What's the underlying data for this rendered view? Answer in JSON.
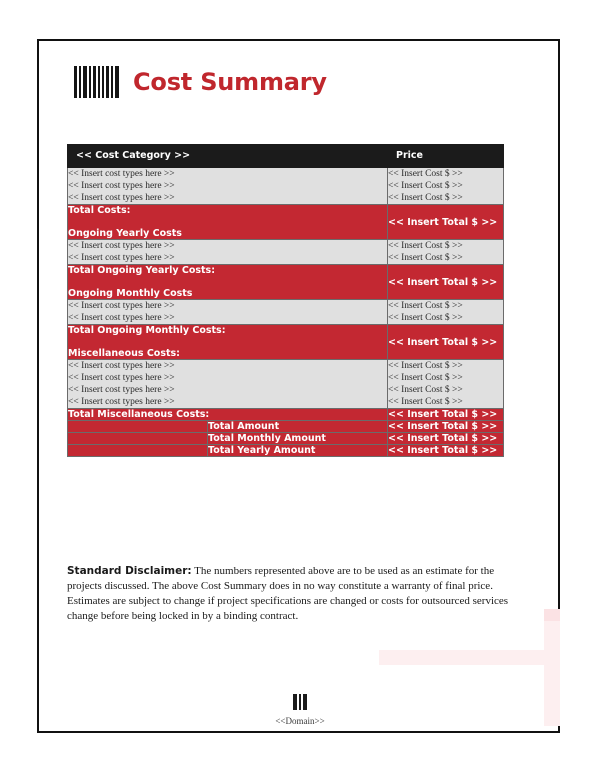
{
  "document": {
    "title": "Cost Summary",
    "logo_icon": "barcode-icon"
  },
  "table": {
    "headers": {
      "category": "<< Cost Category >>",
      "price": "Price"
    },
    "placeholders": {
      "cost_type": "<< Insert cost types here >>",
      "cost_price": "<< Insert Cost $ >>",
      "total_price": "<< Insert Total $ >>"
    },
    "sections": [
      {
        "rows": [
          {
            "label": "<< Insert cost types here >>",
            "price": "<< Insert Cost $ >>"
          },
          {
            "label": "<< Insert cost types here >>",
            "price": "<< Insert Cost $ >>"
          },
          {
            "label": "<< Insert cost types here >>",
            "price": "<< Insert Cost $ >>"
          }
        ],
        "total_label": "Total Costs:",
        "next_heading": "Ongoing Yearly Costs",
        "total_price": "<< Insert Total $ >>"
      },
      {
        "rows": [
          {
            "label": "<< Insert cost types here >>",
            "price": "<< Insert Cost $ >>"
          },
          {
            "label": "<< Insert cost types here >>",
            "price": "<< Insert Cost $ >>"
          }
        ],
        "total_label": "Total Ongoing Yearly Costs:",
        "next_heading": "Ongoing Monthly Costs",
        "total_price": "<< Insert Total $ >>"
      },
      {
        "rows": [
          {
            "label": "<< Insert cost types here >>",
            "price": "<< Insert Cost $ >>"
          },
          {
            "label": "<< Insert cost types here >>",
            "price": "<< Insert Cost $ >>"
          }
        ],
        "total_label": "Total Ongoing Monthly Costs:",
        "next_heading": "Miscellaneous Costs:",
        "total_price": "<< Insert Total $ >>"
      },
      {
        "rows": [
          {
            "label": "<< Insert cost types here >>",
            "price": "<< Insert Cost $ >>"
          },
          {
            "label": "<< Insert cost types here >>",
            "price": "<< Insert Cost $ >>"
          },
          {
            "label": "<< Insert cost types here >>",
            "price": "<< Insert Cost $ >>"
          },
          {
            "label": "<< Insert cost types here >>",
            "price": "<< Insert Cost $ >>"
          }
        ],
        "total_label": "Total Miscellaneous Costs:",
        "next_heading": "",
        "total_price": "<< Insert Total $ >>"
      }
    ],
    "grand_totals": [
      {
        "label": "Total Amount",
        "price": "<< Insert Total $ >>"
      },
      {
        "label": "Total Monthly Amount",
        "price": "<< Insert Total $ >>"
      },
      {
        "label": "Total Yearly Amount",
        "price": "<< Insert Total $ >>"
      }
    ]
  },
  "disclaimer": {
    "heading": "Standard Disclaimer:",
    "body": " The numbers represented above are to be used as an estimate for the projects discussed. The above Cost Summary does in no way constitute a warranty of final price.  Estimates are subject to change if project specifications are changed or costs for outsourced services change before being locked in by a binding contract."
  },
  "footer": {
    "label": "<<Domain>>",
    "logo_icon": "barcode-icon"
  },
  "colors": {
    "brand_red": "#c32832",
    "title_red": "#c0272d",
    "header_black": "#1b1b1b",
    "row_grey": "#e0e0e0",
    "watermark_pink": "#fdeff0"
  }
}
